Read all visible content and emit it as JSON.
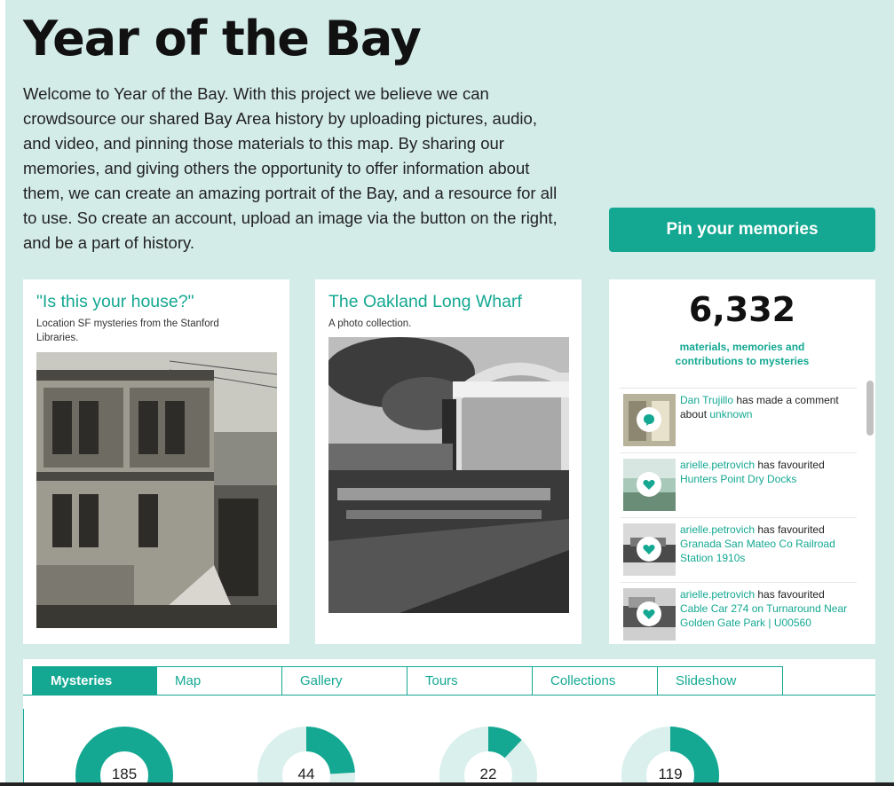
{
  "page": {
    "title": "Year of the Bay",
    "intro": "Welcome to Year of the Bay. With this project we believe we can crowdsource our shared Bay Area history by uploading pictures, audio, and video, and pinning those materials to this map. By sharing our memories, and giving others the opportunity to offer information about them, we can create an amazing portrait of the Bay, and a resource for all to use. So create an account, upload an image via the button on the right, and be a part of history.",
    "pin_button": "Pin your memories"
  },
  "cards": [
    {
      "title": "\"Is this your house?\"",
      "subtitle": "Location SF mysteries from the Stanford Libraries."
    },
    {
      "title": "The Oakland Long Wharf",
      "subtitle": "A photo collection."
    }
  ],
  "stats": {
    "count": "6,332",
    "label": "materials, memories and contributions to mysteries",
    "feed": [
      {
        "user": "Dan Trujillo",
        "action": " has made a comment about ",
        "target": "unknown",
        "icon": "comment-icon"
      },
      {
        "user": "arielle.petrovich",
        "action": " has favourited ",
        "target": "Hunters Point Dry Docks",
        "icon": "heart-icon"
      },
      {
        "user": "arielle.petrovich",
        "action": " has favourited ",
        "target": "Granada San Mateo Co Railroad Station 1910s",
        "icon": "heart-icon"
      },
      {
        "user": "arielle.petrovich",
        "action": " has favourited ",
        "target": "Cable Car 274 on Turnaround Near Golden Gate Park | U00560",
        "icon": "heart-icon"
      }
    ]
  },
  "tabs": [
    "Mysteries",
    "Map",
    "Gallery",
    "Tours",
    "Collections",
    "Slideshow"
  ],
  "active_tab": "Mysteries",
  "donuts": [
    {
      "value": "185",
      "fraction": 1.0
    },
    {
      "value": "44",
      "fraction": 0.24
    },
    {
      "value": "22",
      "fraction": 0.12
    },
    {
      "value": "119",
      "fraction": 0.64
    }
  ],
  "colors": {
    "accent": "#14a892",
    "background": "#d3ece8",
    "donut_track": "#d9f0ec"
  }
}
